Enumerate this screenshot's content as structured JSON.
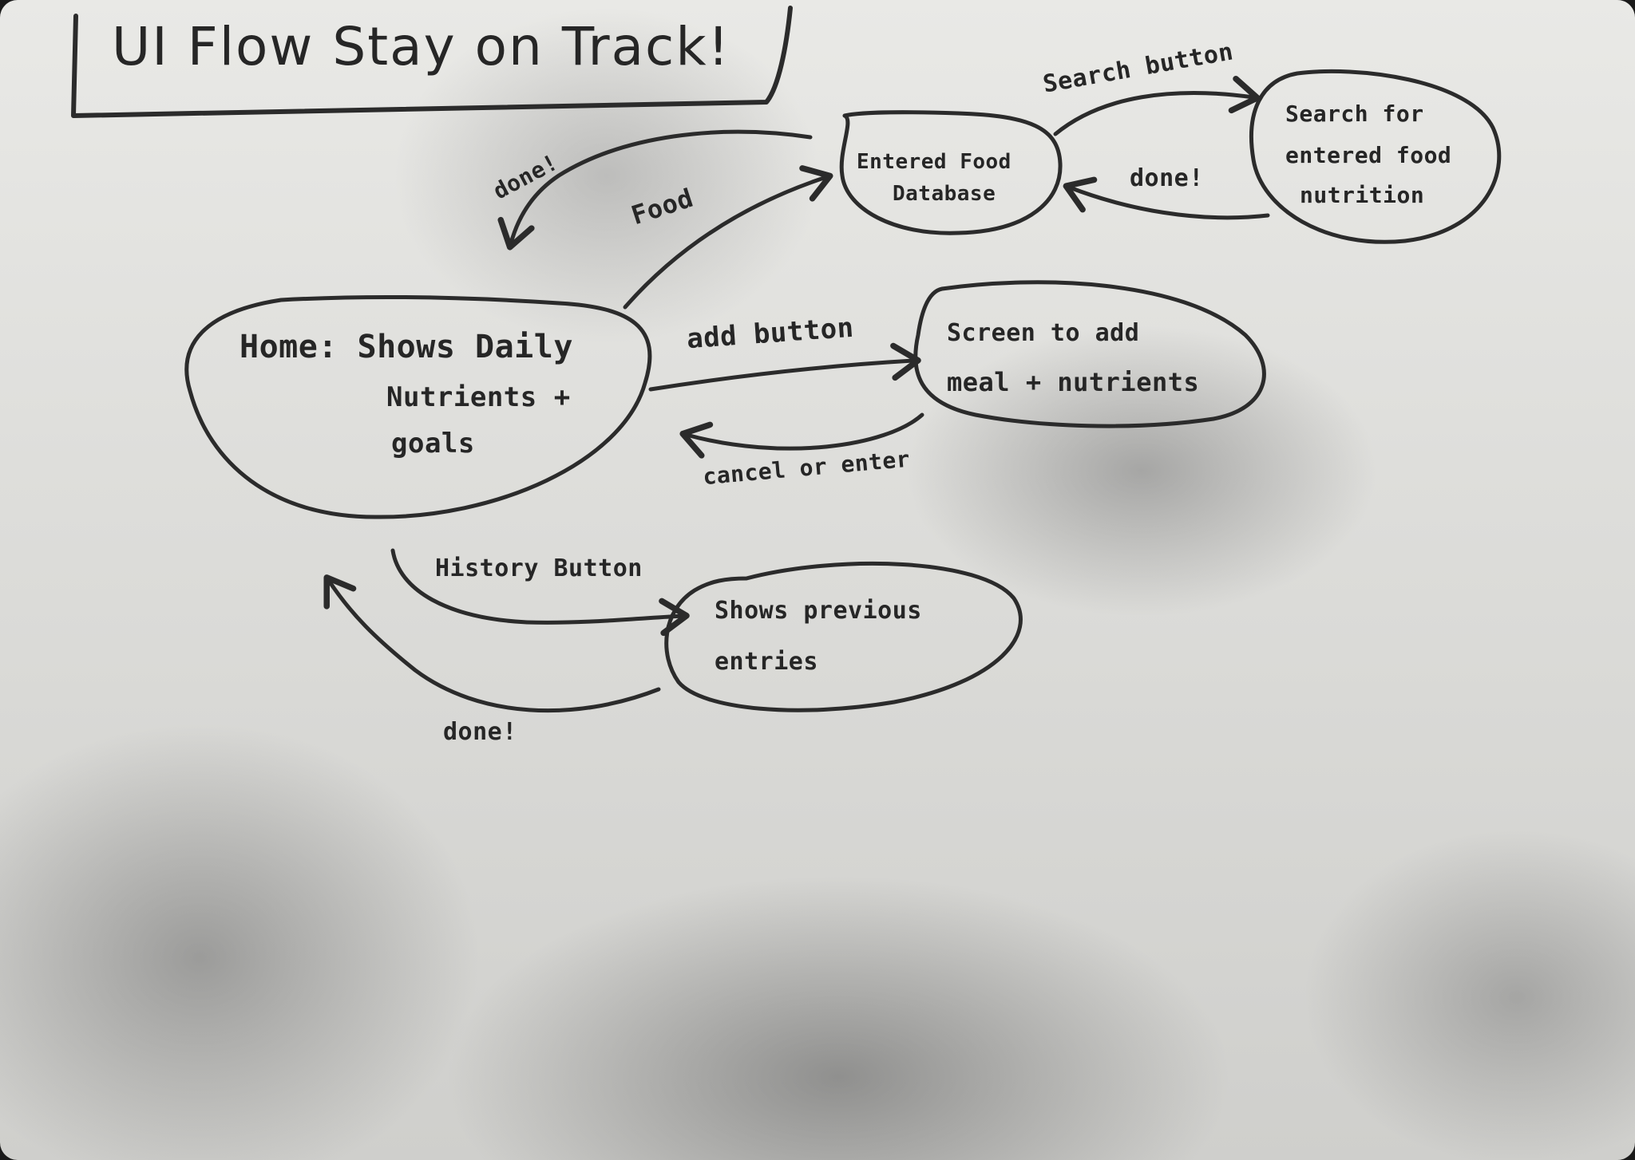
{
  "title": "UI Flow  Stay on Track!",
  "nodes": {
    "home": [
      "Home: Shows Daily",
      "Nutrients +",
      "goals"
    ],
    "food_db": [
      "Entered Food",
      "Database"
    ],
    "search": [
      "Search for",
      "entered food",
      "nutrition"
    ],
    "add_meal": [
      "Screen to add",
      "meal + nutrients"
    ],
    "history": [
      "Shows previous",
      "entries"
    ]
  },
  "edges": {
    "food": "Food",
    "done_db": "done!",
    "search_button": "Search button",
    "done_search": "done!",
    "add_button": "add button",
    "cancel_enter": "cancel or enter",
    "history_button": "History Button",
    "done_history": "done!"
  }
}
